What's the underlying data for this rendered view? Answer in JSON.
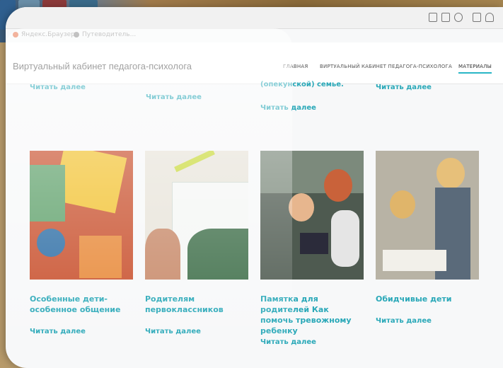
{
  "browser": {
    "tabs": [
      {
        "label": "Яндекс.Браузер"
      },
      {
        "label": "Путеводитель..."
      }
    ]
  },
  "site": {
    "title": "Виртуальный кабинет педагога-психолога",
    "nav": [
      {
        "label": "ГЛАВНАЯ"
      },
      {
        "label": "ВИРТУАЛЬНЫЙ КАБИНЕТ ПЕДАГОГА-ПСИХОЛОГА"
      },
      {
        "label": "МАТЕРИАЛЫ"
      }
    ]
  },
  "previous_row": {
    "snippet_3": "(опекунской) семье.",
    "read_more": "Читать далее"
  },
  "cards": [
    {
      "title": "Особенные дети-особенное общение",
      "read_more": "Читать далее"
    },
    {
      "title": "Родителям первоклассников",
      "read_more": "Читать далее"
    },
    {
      "title": "Памятка для родителей Как помочь тревожному ребенку",
      "read_more": "Читать далее"
    },
    {
      "title": "Обидчивые дети",
      "read_more": "Читать далее"
    }
  ],
  "colors": {
    "accent": "#29a8b8"
  }
}
